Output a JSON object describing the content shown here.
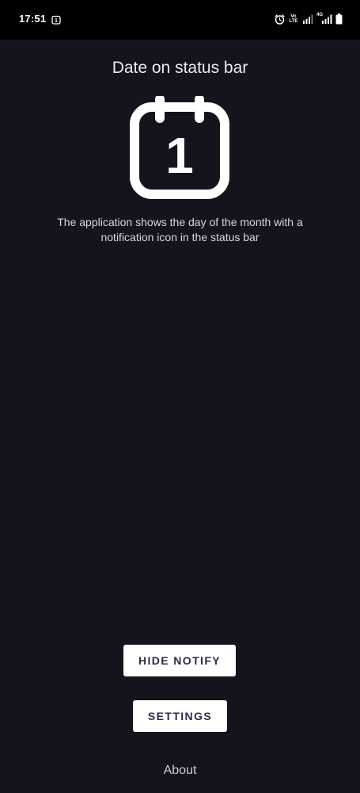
{
  "status_bar": {
    "time": "17:51",
    "notification_day": "1",
    "volte_top": "Vo",
    "volte_bottom": "LTE",
    "network_label": "4G",
    "icons": [
      "notification-date-icon",
      "alarm-icon",
      "volte-icon",
      "signal-icon",
      "signal-icon",
      "battery-icon"
    ]
  },
  "main": {
    "title": "Date on status bar",
    "calendar_day": "1",
    "description": "The application shows the day of the month with a notification icon in the status bar"
  },
  "actions": {
    "hide_notify_label": "HIDE NOTIFY",
    "settings_label": "SETTINGS",
    "about_label": "About"
  },
  "colors": {
    "background": "#15131b",
    "status_bar": "#000000",
    "button_bg": "#ffffff",
    "button_text": "#2e2a4a"
  }
}
